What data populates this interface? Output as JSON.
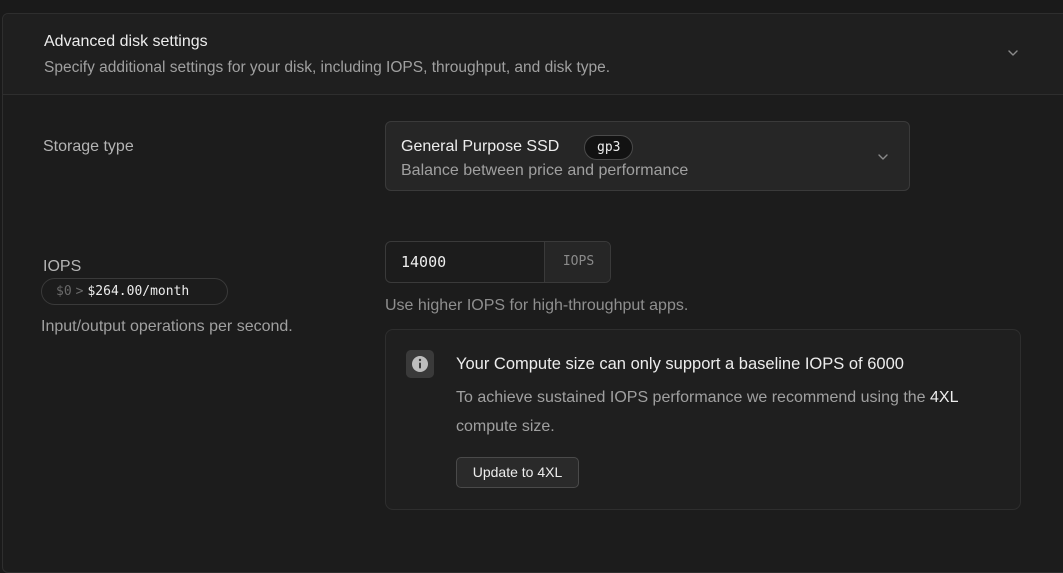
{
  "header": {
    "title": "Advanced disk settings",
    "description": "Specify additional settings for your disk, including IOPS, throughput, and disk type."
  },
  "storage": {
    "label": "Storage type",
    "selected_title": "General Purpose SSD",
    "selected_badge": "gp3",
    "selected_subtitle": "Balance between price and performance"
  },
  "iops": {
    "label": "IOPS",
    "price_old": "$0",
    "price_arrow": ">",
    "price_new": "$264.00/month",
    "description": "Input/output operations per second.",
    "value": "14000",
    "suffix": "IOPS",
    "help": "Use higher IOPS for high-throughput apps."
  },
  "alert": {
    "title": "Your Compute size can only support a baseline IOPS of 6000",
    "body_before": "To achieve sustained IOPS performance we recommend using the",
    "body_strong": "4XL",
    "body_after": "compute size.",
    "button": "Update to 4XL"
  },
  "icons": {
    "header_chevron": "chevron-down-icon",
    "select_chevron": "chevron-down-icon",
    "alert_icon": "info-icon"
  },
  "colors": {
    "background": "#1a1a1a",
    "panel": "#1c1c1c",
    "border": "#2e2e2e",
    "text": "#ededed",
    "muted": "#a0a0a0"
  }
}
